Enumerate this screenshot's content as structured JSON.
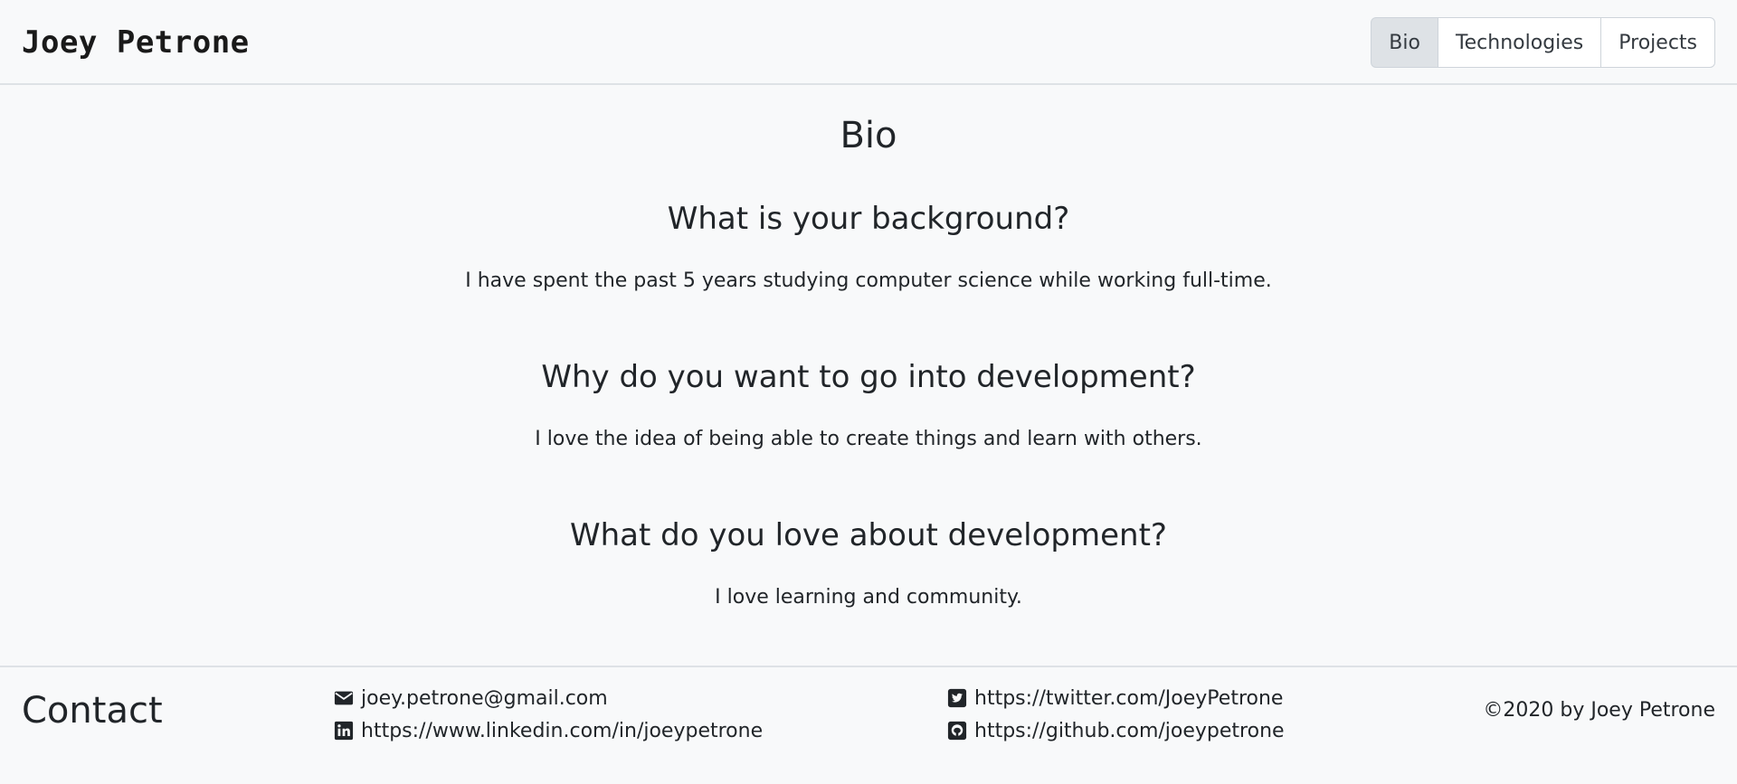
{
  "header": {
    "brand": "Joey Petrone",
    "nav": [
      {
        "label": "Bio",
        "active": true
      },
      {
        "label": "Technologies",
        "active": false
      },
      {
        "label": "Projects",
        "active": false
      }
    ]
  },
  "main": {
    "title": "Bio",
    "sections": [
      {
        "question": "What is your background?",
        "answer": "I have spent the past 5 years studying computer science while working full-time."
      },
      {
        "question": "Why do you want to go into development?",
        "answer": "I love the idea of being able to create things and learn with others."
      },
      {
        "question": "What do you love about development?",
        "answer": "I love learning and community."
      }
    ]
  },
  "footer": {
    "title": "Contact",
    "links": [
      {
        "icon": "envelope-icon",
        "text": "joey.petrone@gmail.com"
      },
      {
        "icon": "linkedin-icon",
        "text": "https://www.linkedin.com/in/joeypetrone"
      },
      {
        "icon": "twitter-icon",
        "text": "https://twitter.com/JoeyPetrone"
      },
      {
        "icon": "github-icon",
        "text": "https://github.com/joeypetrone"
      }
    ],
    "copyright": "©2020 by Joey Petrone"
  },
  "colors": {
    "background": "#f8f9fa",
    "text": "#212529",
    "border": "#dee2e6",
    "active_tab": "#dee2e6"
  }
}
